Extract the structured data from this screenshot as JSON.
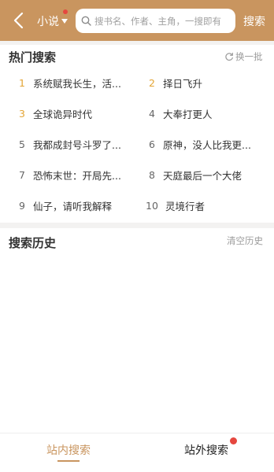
{
  "header": {
    "category_label": "小说",
    "search_placeholder": "搜书名、作者、主角，一搜即有",
    "search_button_label": "搜索"
  },
  "hot_search": {
    "title": "热门搜索",
    "refresh_label": "换一批",
    "items": [
      {
        "rank": "1",
        "name": "系统赋我长生，活..."
      },
      {
        "rank": "2",
        "name": "择日飞升"
      },
      {
        "rank": "3",
        "name": "全球诡异时代"
      },
      {
        "rank": "4",
        "name": "大奉打更人"
      },
      {
        "rank": "5",
        "name": "我都成封号斗罗了..."
      },
      {
        "rank": "6",
        "name": "原神，没人比我更..."
      },
      {
        "rank": "7",
        "name": "恐怖末世：开局先..."
      },
      {
        "rank": "8",
        "name": "天庭最后一个大佬"
      },
      {
        "rank": "9",
        "name": "仙子，请听我解释"
      },
      {
        "rank": "10",
        "name": "灵境行者"
      }
    ]
  },
  "history": {
    "title": "搜索历史",
    "clear_label": "清空历史"
  },
  "tabs": {
    "inside_label": "站内搜索",
    "outside_label": "站外搜索"
  },
  "colors": {
    "brand": "#c9955f",
    "top_rank": "#e3a434",
    "badge": "#e5473f"
  }
}
